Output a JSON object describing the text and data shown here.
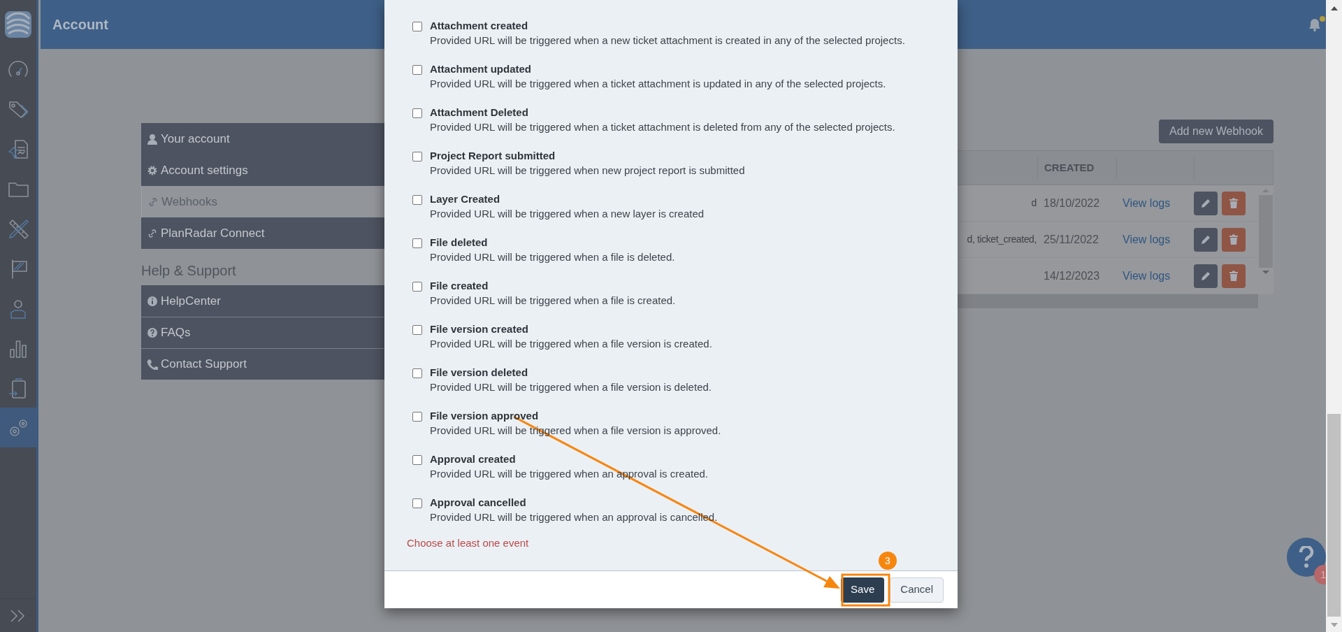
{
  "nav_rail": {
    "items": [
      {
        "selected": false
      },
      {
        "selected": false
      },
      {
        "selected": false
      },
      {
        "selected": false
      },
      {
        "selected": false
      },
      {
        "selected": false
      },
      {
        "selected": false
      },
      {
        "selected": false
      },
      {
        "selected": false
      },
      {
        "selected": true
      }
    ]
  },
  "header": {
    "title": "Account"
  },
  "account_menu": {
    "items": [
      {
        "label": "Your account",
        "selected": false
      },
      {
        "label": "Account settings",
        "selected": false
      },
      {
        "label": "Webhooks",
        "selected": true
      },
      {
        "label": "PlanRadar Connect",
        "selected": false
      }
    ],
    "help_heading": "Help & Support",
    "help_items": [
      {
        "label": "HelpCenter"
      },
      {
        "label": "FAQs"
      },
      {
        "label": "Contact Support"
      }
    ]
  },
  "webhooks": {
    "add_button": "Add new Webhook",
    "columns": [
      "CREATED"
    ],
    "rows": [
      {
        "events": "d",
        "created": "18/10/2022",
        "logs": "View logs"
      },
      {
        "events": "d, ticket_created,",
        "created": "25/11/2022",
        "logs": "View logs"
      },
      {
        "created": "14/12/2023",
        "logs": "View logs"
      }
    ]
  },
  "modal": {
    "events": [
      {
        "title": "Attachment created",
        "description": "Provided URL will be triggered when a new ticket attachment is created in any of the selected projects.",
        "checked": false
      },
      {
        "title": "Attachment updated",
        "description": "Provided URL will be triggered when a ticket attachment is updated in any of the selected projects.",
        "checked": false
      },
      {
        "title": "Attachment Deleted",
        "description": "Provided URL will be triggered when a ticket attachment is deleted from any of the selected projects.",
        "checked": false
      },
      {
        "title": "Project Report submitted",
        "description": "Provided URL will be triggered when new project report is submitted",
        "checked": false
      },
      {
        "title": "Layer Created",
        "description": "Provided URL will be triggered when a new layer is created",
        "checked": false
      },
      {
        "title": "File deleted",
        "description": "Provided URL will be triggered when a file is deleted.",
        "checked": false
      },
      {
        "title": "File created",
        "description": "Provided URL will be triggered when a file is created.",
        "checked": false
      },
      {
        "title": "File version created",
        "description": "Provided URL will be triggered when a file version is created.",
        "checked": false
      },
      {
        "title": "File version deleted",
        "description": "Provided URL will be triggered when a file version is deleted.",
        "checked": false
      },
      {
        "title": "File version approved",
        "description": "Provided URL will be triggered when a file version is approved.",
        "checked": false
      },
      {
        "title": "Approval created",
        "description": "Provided URL will be triggered when an approval is created.",
        "checked": false
      },
      {
        "title": "Approval cancelled",
        "description": "Provided URL will be triggered when an approval is cancelled.",
        "checked": false
      }
    ],
    "error": "Choose at least one event",
    "buttons": [
      {
        "label": "Save",
        "kind": "primary"
      },
      {
        "label": "Cancel",
        "kind": "secondary"
      }
    ]
  },
  "annotation": {
    "step": "3"
  },
  "help_badge": "1"
}
